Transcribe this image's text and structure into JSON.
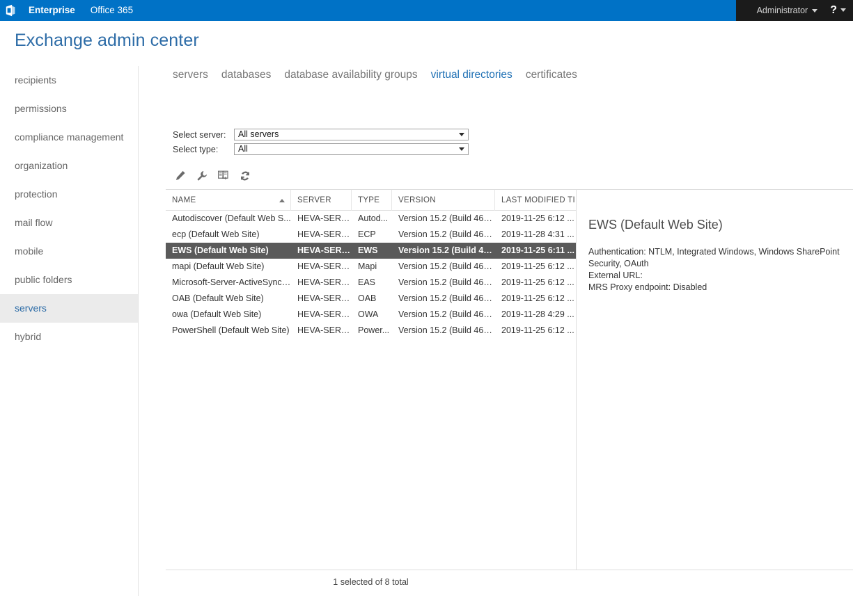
{
  "suite": {
    "logo_icon": "office-logo-icon",
    "enterprise_label": "Enterprise",
    "office365_label": "Office 365",
    "user_label": "Administrator",
    "help_label": "?"
  },
  "page_title": "Exchange admin center",
  "sidebar": {
    "items": [
      {
        "label": "recipients",
        "selected": false
      },
      {
        "label": "permissions",
        "selected": false
      },
      {
        "label": "compliance management",
        "selected": false
      },
      {
        "label": "organization",
        "selected": false
      },
      {
        "label": "protection",
        "selected": false
      },
      {
        "label": "mail flow",
        "selected": false
      },
      {
        "label": "mobile",
        "selected": false
      },
      {
        "label": "public folders",
        "selected": false
      },
      {
        "label": "servers",
        "selected": true
      },
      {
        "label": "hybrid",
        "selected": false
      }
    ]
  },
  "tabs": [
    {
      "label": "servers",
      "active": false
    },
    {
      "label": "databases",
      "active": false
    },
    {
      "label": "database availability groups",
      "active": false
    },
    {
      "label": "virtual directories",
      "active": true
    },
    {
      "label": "certificates",
      "active": false
    }
  ],
  "filters": {
    "server": {
      "label": "Select server:",
      "value": "All servers"
    },
    "type": {
      "label": "Select type:",
      "value": "All"
    }
  },
  "toolbar": {
    "buttons": [
      {
        "icon": "pencil-edit-icon",
        "title": "Edit"
      },
      {
        "icon": "wrench-configure-icon",
        "title": "Configure"
      },
      {
        "icon": "details-document-icon",
        "title": "View details"
      },
      {
        "icon": "refresh-icon",
        "title": "Refresh"
      }
    ]
  },
  "grid": {
    "columns": [
      {
        "key": "name",
        "label": "NAME",
        "sort": "asc"
      },
      {
        "key": "server",
        "label": "SERVER",
        "sort": ""
      },
      {
        "key": "type",
        "label": "TYPE",
        "sort": ""
      },
      {
        "key": "version",
        "label": "VERSION",
        "sort": ""
      },
      {
        "key": "modified",
        "label": "LAST MODIFIED TI...",
        "sort": ""
      }
    ],
    "rows": [
      {
        "name": "Autodiscover (Default Web S...",
        "server": "HEVA-SERV...",
        "type": "Autod...",
        "version": "Version 15.2 (Build 464...",
        "modified": "2019-11-25 6:12 ...",
        "selected": false
      },
      {
        "name": "ecp (Default Web Site)",
        "server": "HEVA-SERV...",
        "type": "ECP",
        "version": "Version 15.2 (Build 464...",
        "modified": "2019-11-28 4:31 ...",
        "selected": false
      },
      {
        "name": "EWS (Default Web Site)",
        "server": "HEVA-SERV...",
        "type": "EWS",
        "version": "Version 15.2 (Build 464...",
        "modified": "2019-11-25 6:11 ...",
        "selected": true
      },
      {
        "name": "mapi (Default Web Site)",
        "server": "HEVA-SERV...",
        "type": "Mapi",
        "version": "Version 15.2 (Build 464...",
        "modified": "2019-11-25 6:12 ...",
        "selected": false
      },
      {
        "name": "Microsoft-Server-ActiveSync ...",
        "server": "HEVA-SERV...",
        "type": "EAS",
        "version": "Version 15.2 (Build 464...",
        "modified": "2019-11-25 6:12 ...",
        "selected": false
      },
      {
        "name": "OAB (Default Web Site)",
        "server": "HEVA-SERV...",
        "type": "OAB",
        "version": "Version 15.2 (Build 464...",
        "modified": "2019-11-25 6:12 ...",
        "selected": false
      },
      {
        "name": "owa (Default Web Site)",
        "server": "HEVA-SERV...",
        "type": "OWA",
        "version": "Version 15.2 (Build 464...",
        "modified": "2019-11-28 4:29 ...",
        "selected": false
      },
      {
        "name": "PowerShell (Default Web Site)",
        "server": "HEVA-SERV...",
        "type": "Power...",
        "version": "Version 15.2 (Build 464...",
        "modified": "2019-11-25 6:12 ...",
        "selected": false
      }
    ]
  },
  "details": {
    "title": "EWS (Default Web Site)",
    "lines": [
      "Authentication: NTLM, Integrated Windows, Windows SharePoint Security, OAuth",
      "External URL:",
      "MRS Proxy endpoint: Disabled"
    ]
  },
  "status": "1 selected of 8 total",
  "colors": {
    "suite_bar": "#0072c6",
    "suite_right": "#1b1b1b",
    "title_blue": "#2d6ca7",
    "tab_active": "#2071b5",
    "row_selected": "#5a5a5a",
    "nav_selected_bg": "#ebebeb"
  }
}
